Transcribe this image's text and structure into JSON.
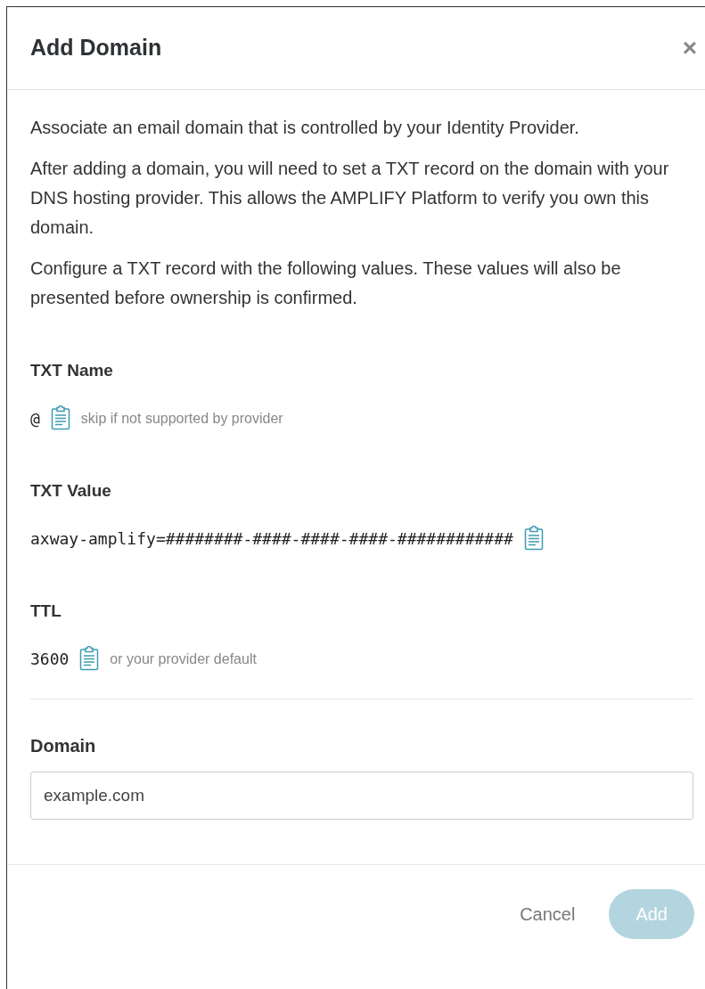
{
  "dialog": {
    "title": "Add Domain",
    "close": "×",
    "paragraphs": [
      "Associate an email domain that is controlled by your Identity Provider.",
      "After adding a domain, you will need to set a TXT record on the domain with your DNS hosting provider. This allows the AMPLIFY Platform to verify you own this domain.",
      "Configure a TXT record with the following values. These values will also be presented before ownership is confirmed."
    ],
    "records": [
      {
        "label": "TXT Name",
        "value": "@",
        "hint": "skip if not supported by provider"
      },
      {
        "label": "TXT Value",
        "value": "axway-amplify=########-####-####-####-############"
      },
      {
        "label": "TTL",
        "value": "3600",
        "hint": "or your provider default"
      }
    ],
    "domain_field": {
      "label": "Domain",
      "placeholder": "example.com"
    },
    "buttons": [
      {
        "label": "Cancel",
        "kind": "link",
        "disabled": false
      },
      {
        "label": "Add",
        "kind": "primary",
        "disabled": true
      }
    ]
  }
}
